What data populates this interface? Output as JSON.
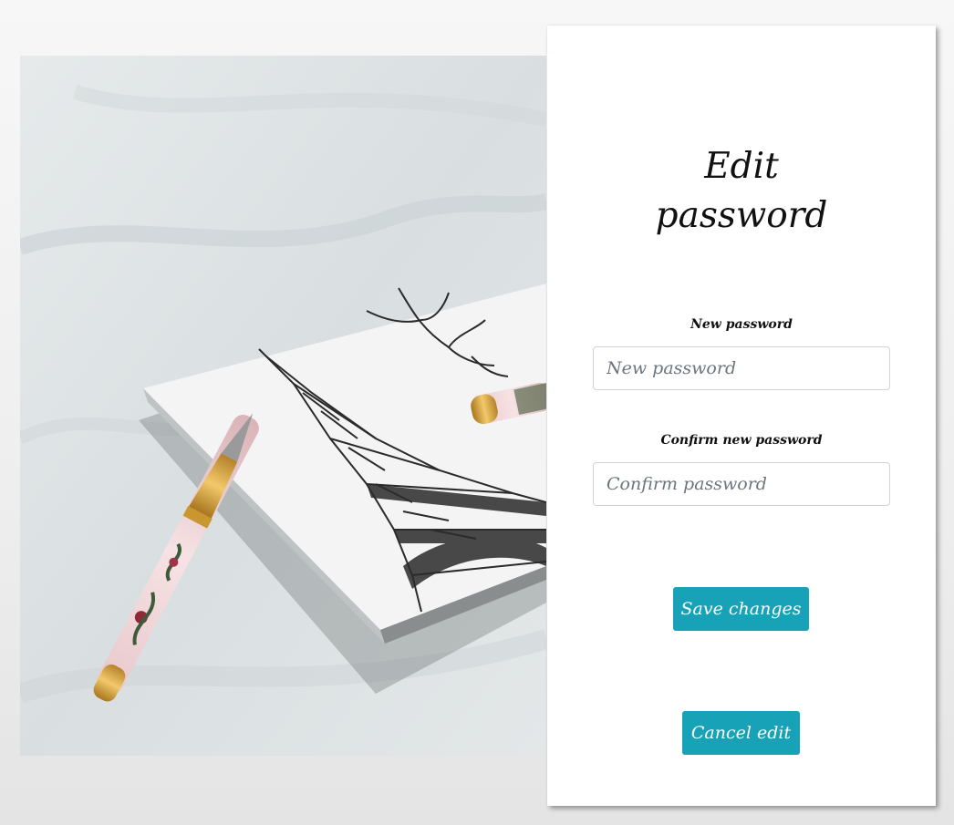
{
  "form": {
    "title_line1": "Edit",
    "title_line2": "password",
    "new_password": {
      "label": "New password",
      "placeholder": "New password",
      "value": ""
    },
    "confirm_password": {
      "label": "Confirm new password",
      "placeholder": "Confirm password",
      "value": ""
    },
    "save_label": "Save changes",
    "cancel_label": "Cancel edit"
  },
  "colors": {
    "accent": "#17a2b8",
    "card_background": "#ffffff",
    "page_background": "#f2f2f2"
  },
  "photo": {
    "subject": "fountain pen on Eiffel tower notebook"
  }
}
